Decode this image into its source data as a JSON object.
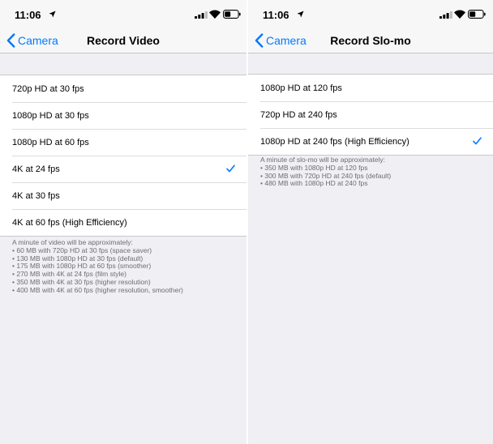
{
  "status": {
    "time": "11:06",
    "icons": [
      "location-arrow-icon",
      "cellular-signal-icon",
      "wifi-icon",
      "battery-icon"
    ]
  },
  "colors": {
    "accent": "#007aff",
    "background": "#efeff4",
    "footer_text": "#6d6d72"
  },
  "left": {
    "back_label": "Camera",
    "title": "Record Video",
    "options": [
      {
        "label": "720p HD at 30 fps",
        "selected": false
      },
      {
        "label": "1080p HD at 30 fps",
        "selected": false
      },
      {
        "label": "1080p HD at 60 fps",
        "selected": false
      },
      {
        "label": "4K at 24 fps",
        "selected": true
      },
      {
        "label": "4K at 30 fps",
        "selected": false
      },
      {
        "label": "4K at 60 fps (High Efficiency)",
        "selected": false
      }
    ],
    "footer": [
      "A minute of video will be approximately:",
      "• 60 MB with 720p HD at 30 fps (space saver)",
      "• 130 MB with 1080p HD at 30 fps (default)",
      "• 175 MB with 1080p HD at 60 fps (smoother)",
      "• 270 MB with 4K at 24 fps (film style)",
      "• 350 MB with 4K at 30 fps (higher resolution)",
      "• 400 MB with 4K at 60 fps (higher resolution, smoother)"
    ]
  },
  "right": {
    "back_label": "Camera",
    "title": "Record Slo-mo",
    "options": [
      {
        "label": "1080p HD at 120 fps",
        "selected": false
      },
      {
        "label": "720p HD at 240 fps",
        "selected": false
      },
      {
        "label": "1080p HD at 240 fps (High Efficiency)",
        "selected": true
      }
    ],
    "footer": [
      "A minute of slo-mo will be approximately:",
      "• 350 MB with 1080p HD at 120 fps",
      "• 300 MB with 720p HD at 240 fps (default)",
      "• 480 MB with 1080p HD at 240 fps"
    ]
  }
}
